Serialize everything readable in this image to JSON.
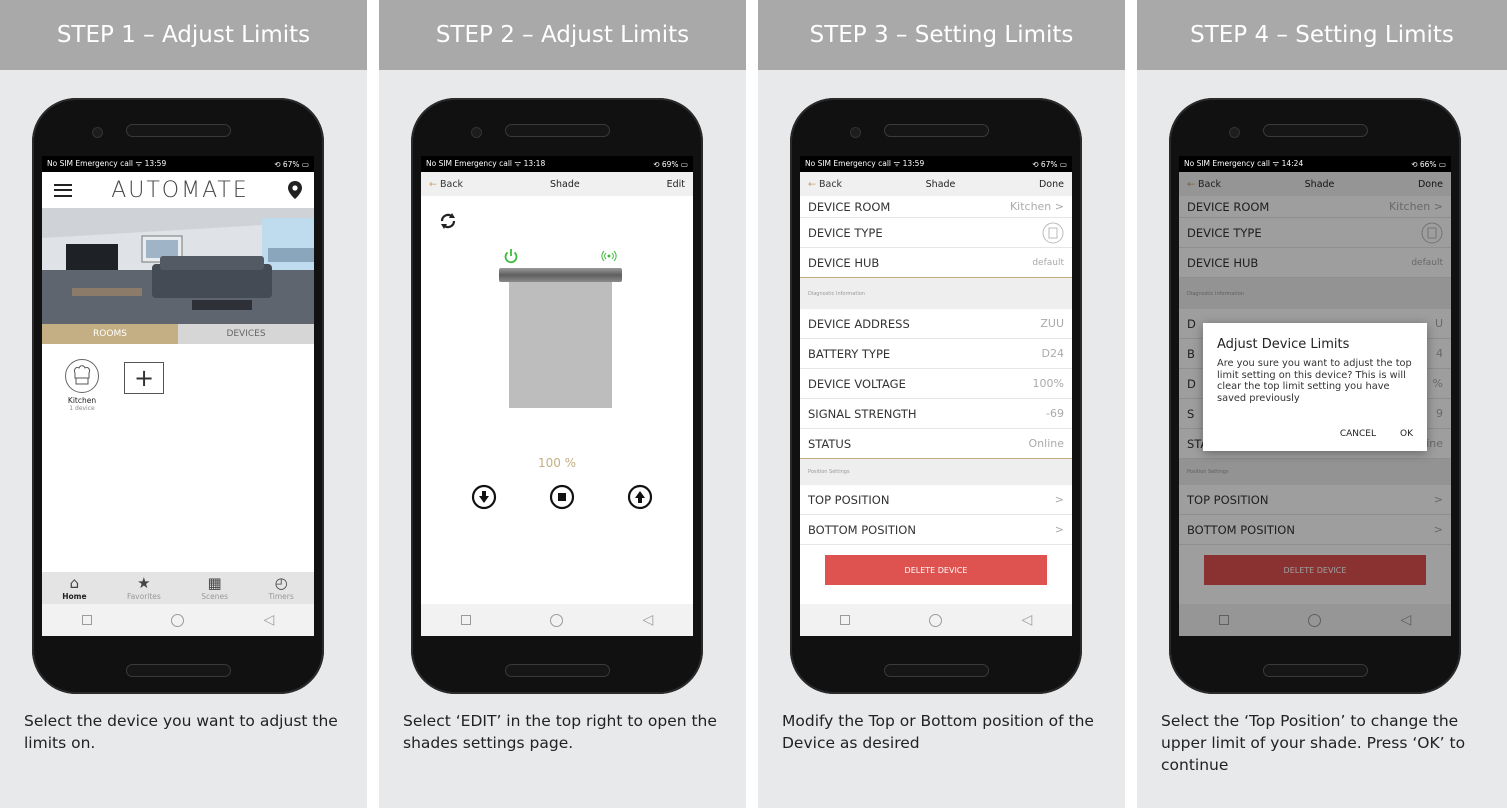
{
  "steps": [
    {
      "title": "STEP 1 – Adjust Limits",
      "caption": "Select the device you want to adjust the limits on.",
      "status": {
        "left": "No SIM  Emergency call ᯤ    13:59",
        "right": "⟲ 67% ▭"
      },
      "app": {
        "logo": "AUTOMATE",
        "tabs": [
          "ROOMS",
          "DEVICES"
        ],
        "room": {
          "name": "Kitchen",
          "count": "1 device"
        },
        "add_glyph": "+",
        "bottom_tabs": [
          {
            "label": "Home",
            "glyph": "⌂",
            "icon": "home-icon"
          },
          {
            "label": "Favorites",
            "glyph": "★",
            "icon": "star-icon"
          },
          {
            "label": "Scenes",
            "glyph": "▦",
            "icon": "film-icon"
          },
          {
            "label": "Timers",
            "glyph": "◴",
            "icon": "clock-icon"
          }
        ]
      }
    },
    {
      "title": "STEP 2 – Adjust Limits",
      "caption": "Select ‘EDIT’ in the top right to open the shades settings page.",
      "status": {
        "left": "No SIM  Emergency call ᯤ    13:18",
        "right": "⟲ 69% ▭"
      },
      "bar": {
        "back": "Back",
        "title": "Shade",
        "action": "Edit"
      },
      "percent": "100 %"
    },
    {
      "title": "STEP 3 – Setting Limits",
      "caption": "Modify the Top or Bottom position of the Device as desired",
      "status": {
        "left": "No SIM  Emergency call ᯤ    13:59",
        "right": "⟲ 67% ▭"
      },
      "bar": {
        "back": "Back",
        "title": "Shade",
        "action": "Done"
      },
      "rows_top": [
        {
          "label": "DEVICE ROOM",
          "value": "Kitchen  >"
        },
        {
          "label": "DEVICE TYPE",
          "value": ""
        },
        {
          "label": "DEVICE HUB",
          "value": "default"
        }
      ],
      "section1": "Diagnostic Information",
      "rows_diag": [
        {
          "label": "DEVICE ADDRESS",
          "value": "ZUU"
        },
        {
          "label": "BATTERY TYPE",
          "value": "D24"
        },
        {
          "label": "DEVICE VOLTAGE",
          "value": "100%"
        },
        {
          "label": "SIGNAL STRENGTH",
          "value": "-69"
        },
        {
          "label": "STATUS",
          "value": "Online"
        }
      ],
      "section2": "Position Settings",
      "rows_pos": [
        {
          "label": "TOP POSITION",
          "value": ">"
        },
        {
          "label": "BOTTOM POSITION",
          "value": ">"
        }
      ],
      "delete_label": "DELETE DEVICE"
    },
    {
      "title": "STEP 4 – Setting Limits",
      "caption": "Select the ‘Top Position’ to change the upper limit of your shade. Press ‘OK’ to continue",
      "status": {
        "left": "No SIM  Emergency call ᯤ    14:24",
        "right": "⟲ 66% ▭"
      },
      "bar": {
        "back": "Back",
        "title": "Shade",
        "action": "Done"
      },
      "rows_top": [
        {
          "label": "DEVICE ROOM",
          "value": "Kitchen  >"
        },
        {
          "label": "DEVICE TYPE",
          "value": ""
        },
        {
          "label": "DEVICE HUB",
          "value": "default"
        }
      ],
      "section1": "Diagnostic Information",
      "rows_diag": [
        {
          "label": "D",
          "value": "U"
        },
        {
          "label": "B",
          "value": "4"
        },
        {
          "label": "D",
          "value": "%"
        },
        {
          "label": "S",
          "value": "9"
        },
        {
          "label": "STATUS",
          "value": "Online"
        }
      ],
      "section2": "Position Settings",
      "rows_pos": [
        {
          "label": "TOP POSITION",
          "value": ">"
        },
        {
          "label": "BOTTOM POSITION",
          "value": ">"
        }
      ],
      "delete_label": "DELETE DEVICE",
      "dialog": {
        "title": "Adjust Device Limits",
        "message": "Are you sure you want to adjust the top limit setting on this device? This is will clear the top limit setting you have saved previously",
        "cancel": "CANCEL",
        "ok": "OK"
      }
    }
  ],
  "colors": {
    "accent_gold": "#c4ae84",
    "delete_red": "#de524f",
    "power_green": "#3dbb3d",
    "header_grey": "#a9a9a9"
  }
}
